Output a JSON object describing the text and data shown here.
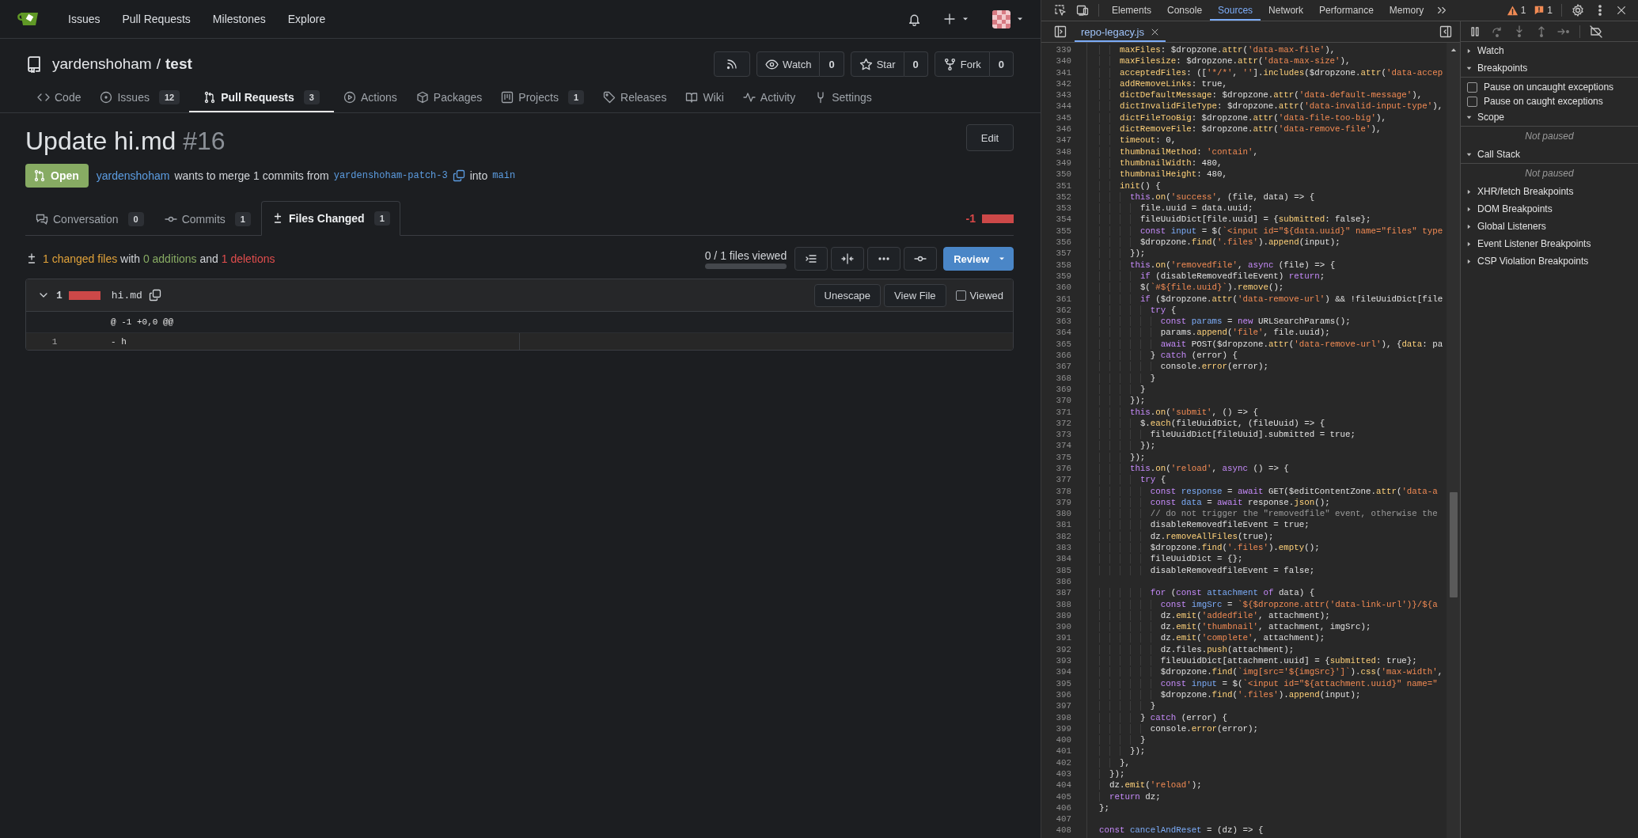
{
  "top_nav": {
    "items": [
      "Issues",
      "Pull Requests",
      "Milestones",
      "Explore"
    ]
  },
  "repo": {
    "owner": "yardenshoham",
    "separator": "/",
    "name": "test",
    "buttons": [
      {
        "label": "Watch",
        "count": "0"
      },
      {
        "label": "Star",
        "count": "0"
      },
      {
        "label": "Fork",
        "count": "0"
      }
    ]
  },
  "repo_tabs": [
    {
      "label": "Code",
      "selected": false
    },
    {
      "label": "Issues",
      "count": "12",
      "selected": false
    },
    {
      "label": "Pull Requests",
      "count": "3",
      "selected": true
    },
    {
      "label": "Actions",
      "selected": false
    },
    {
      "label": "Packages",
      "selected": false
    },
    {
      "label": "Projects",
      "count": "1",
      "selected": false
    },
    {
      "label": "Releases",
      "selected": false
    },
    {
      "label": "Wiki",
      "selected": false
    },
    {
      "label": "Activity",
      "selected": false
    },
    {
      "label": "Settings",
      "selected": false
    }
  ],
  "pull_request": {
    "title": "Update hi.md",
    "number": "#16",
    "edit_button": "Edit",
    "state": "Open",
    "author": "yardenshoham",
    "merge_text": "wants to merge 1 commits from",
    "head_branch": "yardenshoham-patch-3",
    "into_text": "into",
    "base_branch": "main"
  },
  "pr_tabs": [
    {
      "label": "Conversation",
      "count": "0",
      "selected": false
    },
    {
      "label": "Commits",
      "count": "1",
      "selected": false
    },
    {
      "label": "Files Changed",
      "count": "1",
      "selected": true
    }
  ],
  "diffstat": {
    "deletions": "-1"
  },
  "summary": {
    "parts": [
      {
        "kind": "files",
        "text": "1 changed files"
      },
      {
        "kind": "plain",
        "text": "with"
      },
      {
        "kind": "added",
        "text": "0 additions"
      },
      {
        "kind": "plain",
        "text": "and"
      },
      {
        "kind": "deleted",
        "text": "1 deletions"
      }
    ]
  },
  "files_viewed": {
    "text": "0 / 1 files viewed",
    "level": 0
  },
  "review_button": "Review",
  "files": [
    {
      "expanded": true,
      "changes": "1",
      "name": "hi.md",
      "buttons": [
        "Unescape",
        "View File"
      ],
      "viewed": {
        "label": "Viewed",
        "checked": false
      },
      "hunk": "@ -1 +0,0 @@",
      "lines": [
        {
          "old_number": "1",
          "code": "- h"
        }
      ]
    }
  ],
  "devtools": {
    "tabs": [
      {
        "label": "Elements",
        "selected": false
      },
      {
        "label": "Console",
        "selected": false
      },
      {
        "label": "Sources",
        "selected": true
      },
      {
        "label": "Network",
        "selected": false
      },
      {
        "label": "Performance",
        "selected": false
      },
      {
        "label": "Memory",
        "selected": false
      }
    ],
    "warnings": "1",
    "issues": "1",
    "open_file": "repo-legacy.js",
    "code_lines": [
      {
        "number": "339",
        "code": "    maxFiles: $dropzone.attr('data-max-file'),"
      },
      {
        "number": "340",
        "code": "    maxFilesize: $dropzone.attr('data-max-size'),"
      },
      {
        "number": "341",
        "code": "    acceptedFiles: (['*/*', ''].includes($dropzone.attr('data-accep"
      },
      {
        "number": "342",
        "code": "    addRemoveLinks: true,"
      },
      {
        "number": "343",
        "code": "    dictDefaultMessage: $dropzone.attr('data-default-message'),"
      },
      {
        "number": "344",
        "code": "    dictInvalidFileType: $dropzone.attr('data-invalid-input-type'),"
      },
      {
        "number": "345",
        "code": "    dictFileTooBig: $dropzone.attr('data-file-too-big'),"
      },
      {
        "number": "346",
        "code": "    dictRemoveFile: $dropzone.attr('data-remove-file'),"
      },
      {
        "number": "347",
        "code": "    timeout: 0,"
      },
      {
        "number": "348",
        "code": "    thumbnailMethod: 'contain',"
      },
      {
        "number": "349",
        "code": "    thumbnailWidth: 480,"
      },
      {
        "number": "350",
        "code": "    thumbnailHeight: 480,"
      },
      {
        "number": "351",
        "code": "    init() {"
      },
      {
        "number": "352",
        "code": "      this.on('success', (file, data) => {"
      },
      {
        "number": "353",
        "code": "        file.uuid = data.uuid;"
      },
      {
        "number": "354",
        "code": "        fileUuidDict[file.uuid] = {submitted: false};"
      },
      {
        "number": "355",
        "code": "        const input = $(`<input id=\"${data.uuid}\" name=\"files\" type"
      },
      {
        "number": "356",
        "code": "        $dropzone.find('.files').append(input);"
      },
      {
        "number": "357",
        "code": "      });"
      },
      {
        "number": "358",
        "code": "      this.on('removedfile', async (file) => {"
      },
      {
        "number": "359",
        "code": "        if (disableRemovedfileEvent) return;"
      },
      {
        "number": "360",
        "code": "        $(`#${file.uuid}`).remove();"
      },
      {
        "number": "361",
        "code": "        if ($dropzone.attr('data-remove-url') && !fileUuidDict[file"
      },
      {
        "number": "362",
        "code": "          try {"
      },
      {
        "number": "363",
        "code": "            const params = new URLSearchParams();"
      },
      {
        "number": "364",
        "code": "            params.append('file', file.uuid);"
      },
      {
        "number": "365",
        "code": "            await POST($dropzone.attr('data-remove-url'), {data: pa"
      },
      {
        "number": "366",
        "code": "          } catch (error) {"
      },
      {
        "number": "367",
        "code": "            console.error(error);"
      },
      {
        "number": "368",
        "code": "          }"
      },
      {
        "number": "369",
        "code": "        }"
      },
      {
        "number": "370",
        "code": "      });"
      },
      {
        "number": "371",
        "code": "      this.on('submit', () => {"
      },
      {
        "number": "372",
        "code": "        $.each(fileUuidDict, (fileUuid) => {"
      },
      {
        "number": "373",
        "code": "          fileUuidDict[fileUuid].submitted = true;"
      },
      {
        "number": "374",
        "code": "        });"
      },
      {
        "number": "375",
        "code": "      });"
      },
      {
        "number": "376",
        "code": "      this.on('reload', async () => {"
      },
      {
        "number": "377",
        "code": "        try {"
      },
      {
        "number": "378",
        "code": "          const response = await GET($editContentZone.attr('data-a"
      },
      {
        "number": "379",
        "code": "          const data = await response.json();"
      },
      {
        "number": "380",
        "code": "          // do not trigger the \"removedfile\" event, otherwise the"
      },
      {
        "number": "381",
        "code": "          disableRemovedfileEvent = true;"
      },
      {
        "number": "382",
        "code": "          dz.removeAllFiles(true);"
      },
      {
        "number": "383",
        "code": "          $dropzone.find('.files').empty();"
      },
      {
        "number": "384",
        "code": "          fileUuidDict = {};"
      },
      {
        "number": "385",
        "code": "          disableRemovedfileEvent = false;"
      },
      {
        "number": "386"
      },
      {
        "number": "387",
        "code": "          for (const attachment of data) {"
      },
      {
        "number": "388",
        "code": "            const imgSrc = `${$dropzone.attr('data-link-url')}/${a"
      },
      {
        "number": "389",
        "code": "            dz.emit('addedfile', attachment);"
      },
      {
        "number": "390",
        "code": "            dz.emit('thumbnail', attachment, imgSrc);"
      },
      {
        "number": "391",
        "code": "            dz.emit('complete', attachment);"
      },
      {
        "number": "392",
        "code": "            dz.files.push(attachment);"
      },
      {
        "number": "393",
        "code": "            fileUuidDict[attachment.uuid] = {submitted: true};"
      },
      {
        "number": "394",
        "code": "            $dropzone.find(`img[src='${imgSrc}']`).css('max-width',"
      },
      {
        "number": "395",
        "code": "            const input = $(`<input id=\"${attachment.uuid}\" name=\""
      },
      {
        "number": "396",
        "code": "            $dropzone.find('.files').append(input);"
      },
      {
        "number": "397",
        "code": "          }"
      },
      {
        "number": "398",
        "code": "        } catch (error) {"
      },
      {
        "number": "399",
        "code": "          console.error(error);"
      },
      {
        "number": "400",
        "code": "        }"
      },
      {
        "number": "401",
        "code": "      });"
      },
      {
        "number": "402",
        "code": "    },"
      },
      {
        "number": "403",
        "code": "  });"
      },
      {
        "number": "404",
        "code": "  dz.emit('reload');"
      },
      {
        "number": "405",
        "code": "  return dz;"
      },
      {
        "number": "406",
        "code": "};"
      },
      {
        "number": "407"
      },
      {
        "number": "408",
        "code": "const cancelAndReset = (dz) => {"
      }
    ],
    "sidebar": [
      {
        "title": "Watch",
        "expanded": false
      },
      {
        "title": "Breakpoints",
        "expanded": true,
        "checkboxes": [
          {
            "label": "Pause on uncaught exceptions",
            "checked": false
          },
          {
            "label": "Pause on caught exceptions",
            "checked": false
          }
        ]
      },
      {
        "title": "Scope",
        "expanded": true,
        "message": "Not paused"
      },
      {
        "title": "Call Stack",
        "expanded": true,
        "message": "Not paused"
      },
      {
        "title": "XHR/fetch Breakpoints",
        "expanded": false
      },
      {
        "title": "DOM Breakpoints",
        "expanded": false
      },
      {
        "title": "Global Listeners",
        "expanded": false
      },
      {
        "title": "Event Listener Breakpoints",
        "expanded": false
      },
      {
        "title": "CSP Violation Breakpoints",
        "expanded": false
      }
    ]
  }
}
